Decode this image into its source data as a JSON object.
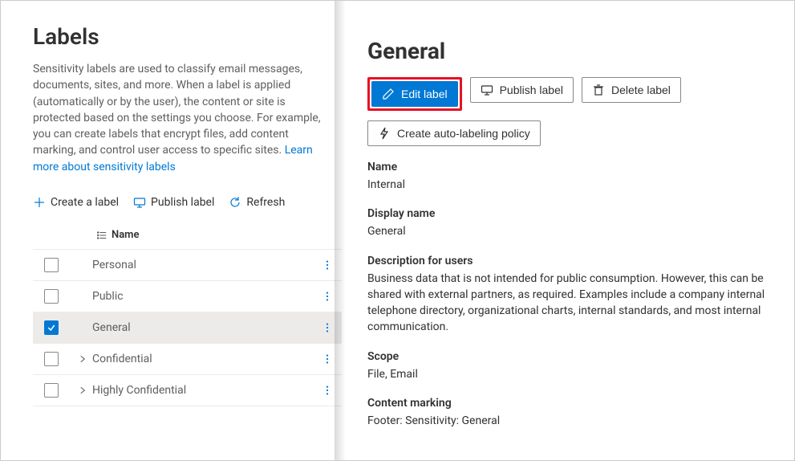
{
  "left": {
    "title": "Labels",
    "intro_prefix": "Sensitivity labels are used to classify email messages, documents, sites, and more. When a label is applied (automatically or by the user), the content or site is protected based on the settings you choose. For example, you can create labels that encrypt files, add content marking, and control user access to specific sites. ",
    "intro_link": "Learn more about sensitivity labels",
    "commands": {
      "create": "Create a label",
      "publish": "Publish label",
      "refresh": "Refresh"
    },
    "columns": {
      "name": "Name"
    },
    "rows": [
      {
        "name": "Personal",
        "expandable": false,
        "checked": false
      },
      {
        "name": "Public",
        "expandable": false,
        "checked": false
      },
      {
        "name": "General",
        "expandable": false,
        "checked": true
      },
      {
        "name": "Confidential",
        "expandable": true,
        "checked": false
      },
      {
        "name": "Highly Confidential",
        "expandable": true,
        "checked": false
      }
    ]
  },
  "right": {
    "title": "General",
    "buttons": {
      "edit": "Edit label",
      "publish": "Publish label",
      "delete": "Delete label",
      "auto": "Create auto-labeling policy"
    },
    "sections": [
      {
        "title": "Name",
        "value": "Internal"
      },
      {
        "title": "Display name",
        "value": "General"
      },
      {
        "title": "Description for users",
        "value": "Business data that is not intended for public consumption. However, this can be shared with external partners, as required. Examples include a company internal telephone directory, organizational charts, internal standards, and most internal communication."
      },
      {
        "title": "Scope",
        "value": "File, Email"
      },
      {
        "title": "Content marking",
        "value": "Footer: Sensitivity: General"
      }
    ]
  }
}
